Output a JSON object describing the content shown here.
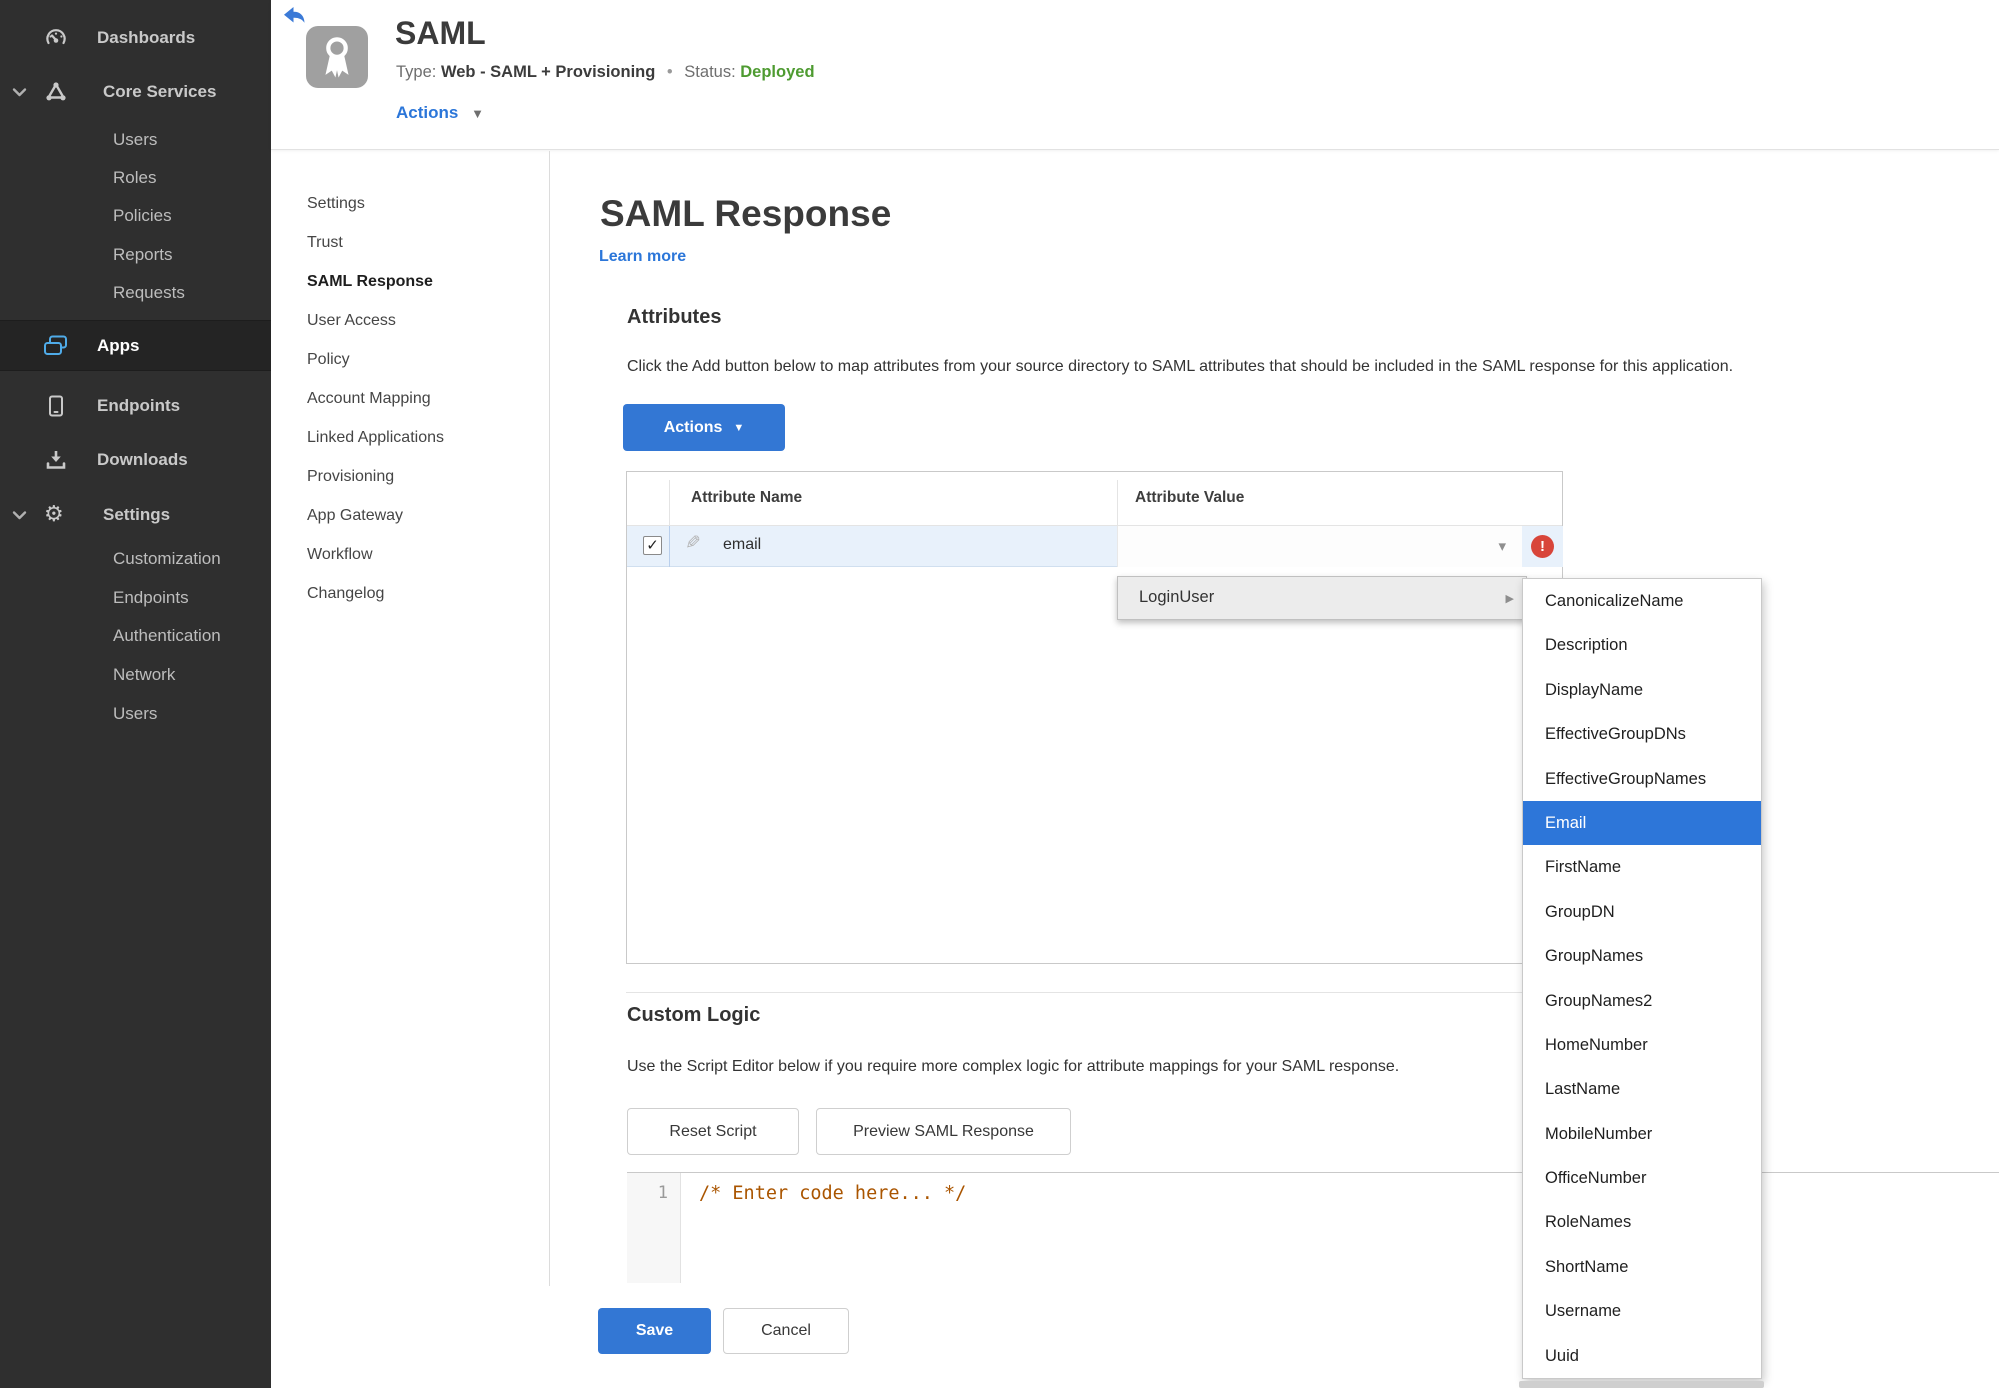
{
  "colors": {
    "accent": "#3377d4",
    "selection": "#2d76d9",
    "link": "#2b76d9",
    "deployed": "#4e9b31",
    "error": "#d8453a",
    "comment": "#aa5500"
  },
  "icons": {
    "caret_down": "▼",
    "caret_down_small": "▾",
    "caret_right": "▶",
    "check": "✓",
    "exclamation": "!",
    "pencil": "✎",
    "gear": "⚙"
  },
  "sidebar": {
    "items": [
      {
        "label": "Dashboards"
      },
      {
        "label": "Core Services"
      },
      {
        "label": "Users"
      },
      {
        "label": "Roles"
      },
      {
        "label": "Policies"
      },
      {
        "label": "Reports"
      },
      {
        "label": "Requests"
      },
      {
        "label": "Apps"
      },
      {
        "label": "Endpoints"
      },
      {
        "label": "Downloads"
      },
      {
        "label": "Settings"
      },
      {
        "label": "Customization"
      },
      {
        "label": "Endpoints"
      },
      {
        "label": "Authentication"
      },
      {
        "label": "Network"
      },
      {
        "label": "Users"
      }
    ]
  },
  "header": {
    "title": "SAML",
    "type_label": "Type:",
    "type_value": "Web - SAML + Provisioning",
    "separator": "•",
    "status_label": "Status:",
    "status_value": "Deployed",
    "actions_label": "Actions"
  },
  "subnav": {
    "active": "SAML Response",
    "items": [
      "Settings",
      "Trust",
      "SAML Response",
      "User Access",
      "Policy",
      "Account Mapping",
      "Linked Applications",
      "Provisioning",
      "App Gateway",
      "Workflow",
      "Changelog"
    ]
  },
  "main": {
    "title": "SAML Response",
    "learn_more": "Learn more",
    "attributes": {
      "heading": "Attributes",
      "description": "Click the Add button below to map attributes from your source directory to SAML attributes that should be included in the SAML response for this application.",
      "actions_button": "Actions",
      "table": {
        "columns": [
          "Attribute Name",
          "Attribute Value"
        ],
        "rows": [
          {
            "name": "email",
            "value": "",
            "checked": true,
            "error": true
          }
        ]
      }
    },
    "value_menu": {
      "label": "LoginUser"
    },
    "submenu": {
      "selected": "Email",
      "items": [
        "CanonicalizeName",
        "Description",
        "DisplayName",
        "EffectiveGroupDNs",
        "EffectiveGroupNames",
        "Email",
        "FirstName",
        "GroupDN",
        "GroupNames",
        "GroupNames2",
        "HomeNumber",
        "LastName",
        "MobileNumber",
        "OfficeNumber",
        "RoleNames",
        "ShortName",
        "Username",
        "Uuid"
      ]
    },
    "custom_logic": {
      "heading": "Custom Logic",
      "description": "Use the Script Editor below if you require more complex logic for attribute mappings for your SAML response.",
      "reset_button": "Reset Script",
      "preview_button": "Preview SAML Response",
      "editor": {
        "line_number": "1",
        "code": "/* Enter code here... */"
      }
    },
    "footer": {
      "save": "Save",
      "cancel": "Cancel"
    }
  }
}
